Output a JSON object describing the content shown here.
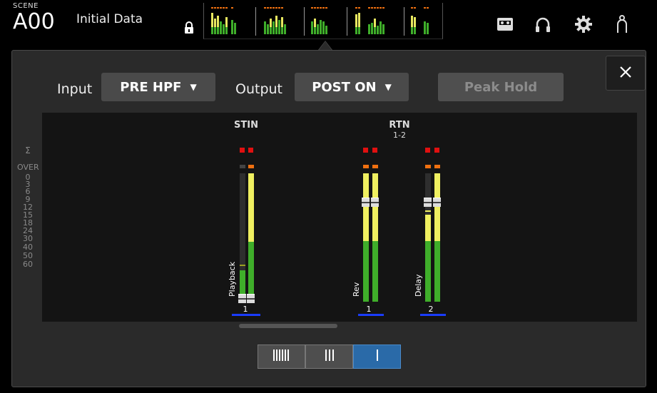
{
  "header": {
    "scene_label": "SCENE",
    "scene_number": "A00",
    "scene_title": "Initial Data"
  },
  "icons": {
    "lock": "lock-icon",
    "recorder": "recorder-icon",
    "monitor": "headphones-icon",
    "setup": "gear-icon",
    "user": "user-icon",
    "close": "close-icon"
  },
  "controls": {
    "input_label": "Input",
    "input_value": "PRE HPF",
    "output_label": "Output",
    "output_value": "POST ON",
    "peak_hold_label": "Peak Hold"
  },
  "scale": [
    "Σ",
    "OVER",
    "0",
    "3",
    "6",
    "9",
    "12",
    "15",
    "18",
    "24",
    "30",
    "40",
    "50",
    "60"
  ],
  "groups": {
    "stin": "STIN",
    "rtn_line1": "RTN",
    "rtn_line2": "1-2"
  },
  "channels": {
    "stin1": {
      "name": "Playback",
      "number": "1"
    },
    "rtn1": {
      "name": "Rev",
      "number": "1"
    },
    "rtn2": {
      "name": "Delay",
      "number": "2"
    }
  },
  "view_buttons": {
    "active": "single"
  },
  "colors": {
    "accent_blue": "#2a6aa8",
    "meter_green": "#3fae2a",
    "meter_yellow": "#f0f060",
    "peak_red": "#e01010",
    "peak_orange": "#f07010",
    "channel_blue": "#1a3cff"
  }
}
